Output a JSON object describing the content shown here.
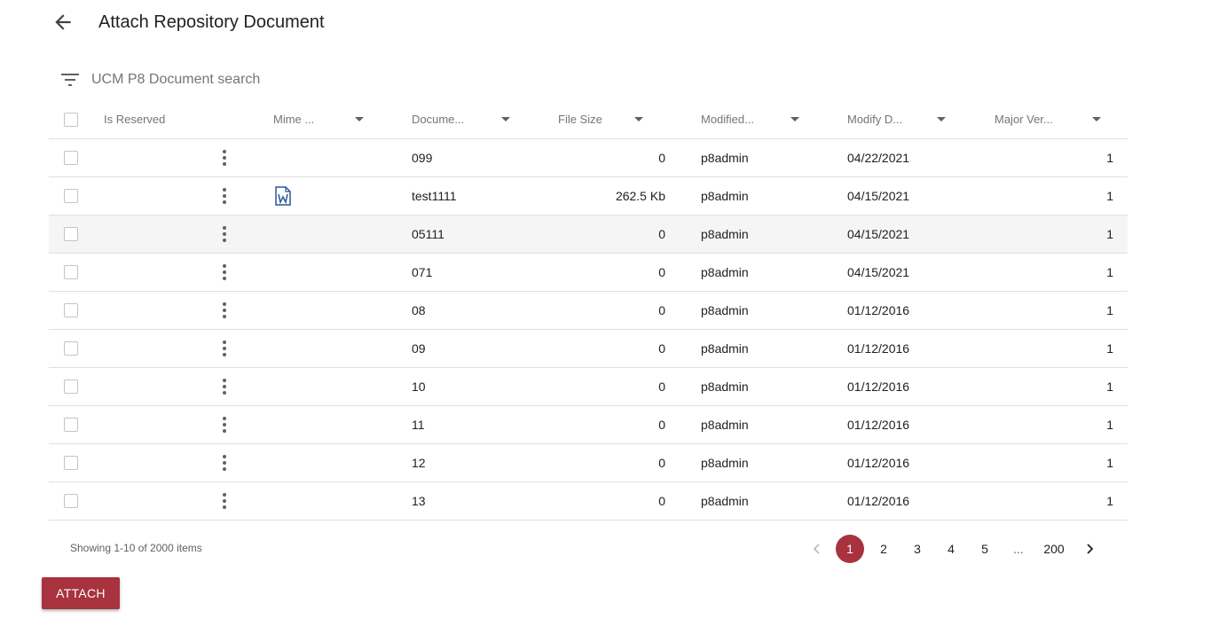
{
  "header": {
    "title": "Attach Repository Document"
  },
  "search": {
    "placeholder": "UCM P8 Document search"
  },
  "columns": [
    "Is Reserved",
    "Mime ...",
    "Docume...",
    "File Size",
    "Modified...",
    "Modify D...",
    "Major Ver..."
  ],
  "rows": [
    {
      "mime": "",
      "document": "099",
      "file_size": "0",
      "modified_by": "p8admin",
      "modify_date": "04/22/2021",
      "major_version": "1"
    },
    {
      "mime": "word-document-icon",
      "document": "test1111",
      "file_size": "262.5 Kb",
      "modified_by": "p8admin",
      "modify_date": "04/15/2021",
      "major_version": "1"
    },
    {
      "mime": "",
      "document": "05111",
      "file_size": "0",
      "modified_by": "p8admin",
      "modify_date": "04/15/2021",
      "major_version": "1"
    },
    {
      "mime": "",
      "document": "071",
      "file_size": "0",
      "modified_by": "p8admin",
      "modify_date": "04/15/2021",
      "major_version": "1"
    },
    {
      "mime": "",
      "document": "08",
      "file_size": "0",
      "modified_by": "p8admin",
      "modify_date": "01/12/2016",
      "major_version": "1"
    },
    {
      "mime": "",
      "document": "09",
      "file_size": "0",
      "modified_by": "p8admin",
      "modify_date": "01/12/2016",
      "major_version": "1"
    },
    {
      "mime": "",
      "document": "10",
      "file_size": "0",
      "modified_by": "p8admin",
      "modify_date": "01/12/2016",
      "major_version": "1"
    },
    {
      "mime": "",
      "document": "11",
      "file_size": "0",
      "modified_by": "p8admin",
      "modify_date": "01/12/2016",
      "major_version": "1"
    },
    {
      "mime": "",
      "document": "12",
      "file_size": "0",
      "modified_by": "p8admin",
      "modify_date": "01/12/2016",
      "major_version": "1"
    },
    {
      "mime": "",
      "document": "13",
      "file_size": "0",
      "modified_by": "p8admin",
      "modify_date": "01/12/2016",
      "major_version": "1"
    }
  ],
  "footer": {
    "status": "Showing 1-10 of 2000 items",
    "pages": [
      "1",
      "2",
      "3",
      "4",
      "5",
      "...",
      "200"
    ],
    "current_page": "1"
  },
  "actions": {
    "attach_label": "ATTACH"
  },
  "colors": {
    "accent": "#a8323e",
    "word_icon": "#2b579a",
    "row_highlight": "#f5f5f5"
  }
}
